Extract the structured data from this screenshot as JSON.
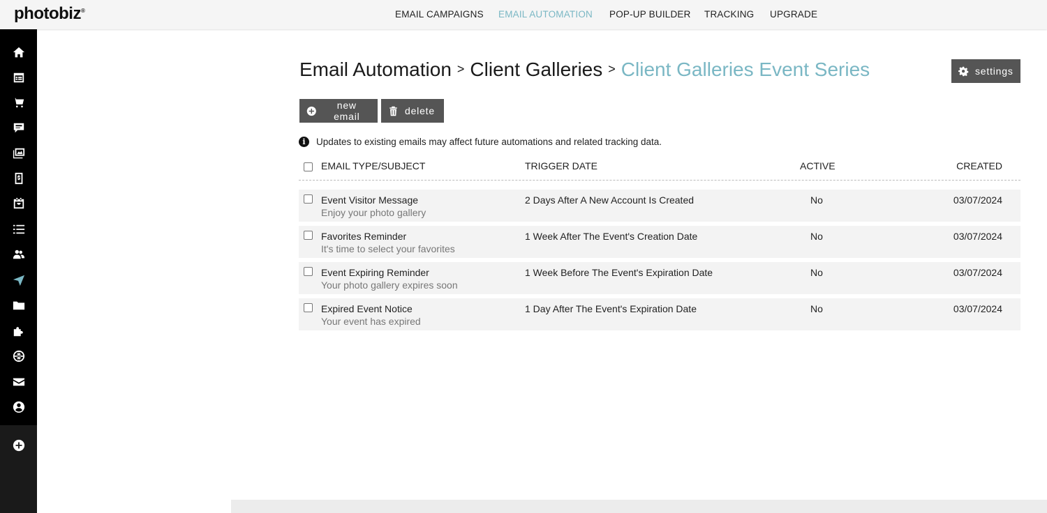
{
  "logo": "photobiz",
  "topnav": [
    "EMAIL CAMPAIGNS",
    "EMAIL AUTOMATION",
    "POP-UP BUILDER",
    "TRACKING",
    "UPGRADE"
  ],
  "sidebar_icons": [
    "home-icon",
    "calendar-icon",
    "cart-icon",
    "chat-icon",
    "gallery-icon",
    "invoice-icon",
    "events-icon",
    "list-icon",
    "contacts-icon",
    "send-icon",
    "folder-icon",
    "puzzle-icon",
    "globe-icon",
    "mail-icon",
    "user-icon",
    "add-icon"
  ],
  "breadcrumb": {
    "part1": "Email Automation",
    "sep": ">",
    "part2": "Client Galleries",
    "current": "Client Galleries Event Series"
  },
  "buttons": {
    "settings": "settings",
    "new_email": "new email",
    "delete": "delete"
  },
  "notice": "Updates to existing emails may affect future automations and related tracking data.",
  "table": {
    "headers": {
      "type": "EMAIL TYPE/SUBJECT",
      "trigger": "TRIGGER DATE",
      "active": "ACTIVE",
      "created": "CREATED"
    },
    "rows": [
      {
        "title": "Event Visitor Message",
        "subject": "Enjoy your photo gallery",
        "trigger": "2 Days After A New Account Is Created",
        "active": "No",
        "created": "03/07/2024"
      },
      {
        "title": "Favorites Reminder",
        "subject": "It's time to select your favorites",
        "trigger": "1 Week After The Event's Creation Date",
        "active": "No",
        "created": "03/07/2024"
      },
      {
        "title": "Event Expiring Reminder",
        "subject": "Your photo gallery expires soon",
        "trigger": "1 Week Before The Event's Expiration Date",
        "active": "No",
        "created": "03/07/2024"
      },
      {
        "title": "Expired Event Notice",
        "subject": "Your event has expired",
        "trigger": "1 Day After The Event's Expiration Date",
        "active": "No",
        "created": "03/07/2024"
      }
    ]
  },
  "colors": {
    "accent": "#7ab7c4",
    "button": "#555555",
    "sidebar": "#000000"
  }
}
